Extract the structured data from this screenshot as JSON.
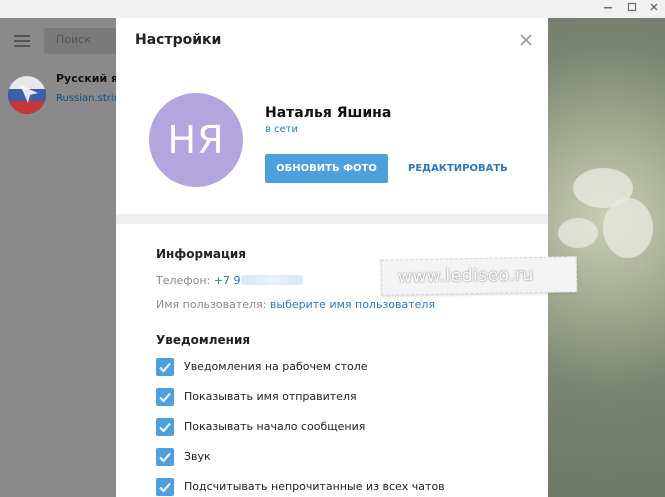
{
  "background_app": {
    "search_placeholder": "Поиск",
    "chat": {
      "title": "Русский язык",
      "subtitle": "Russian.strings"
    }
  },
  "settings": {
    "title": "Настройки",
    "profile": {
      "initials": "НЯ",
      "name": "Наталья Яшина",
      "status": "в сети",
      "update_photo_label": "ОБНОВИТЬ ФОТО",
      "edit_label": "РЕДАКТИРОВАТЬ"
    },
    "info": {
      "title": "Информация",
      "phone_label": "Телефон:",
      "phone_value": "+7 9",
      "username_label": "Имя пользователя:",
      "username_link": "выберите имя пользователя"
    },
    "notifications": {
      "title": "Уведомления",
      "items": [
        {
          "label": "Уведомления на рабочем столе",
          "checked": true
        },
        {
          "label": "Показывать имя отправителя",
          "checked": true
        },
        {
          "label": "Показывать начало сообщения",
          "checked": true
        },
        {
          "label": "Звук",
          "checked": true
        },
        {
          "label": "Подсчитывать непрочитанные из всех чатов",
          "checked": true
        }
      ]
    }
  },
  "watermark": "www.lediseo.ru",
  "colors": {
    "accent": "#4da0dc",
    "link": "#2b7bb9",
    "avatar_bg": "#b3a5dd"
  },
  "icons": {
    "minimize": "minimize-icon",
    "maximize": "maximize-icon",
    "close_window": "close-icon",
    "menu": "hamburger-icon",
    "close_panel": "close-icon",
    "checkbox": "checkmark-icon"
  }
}
